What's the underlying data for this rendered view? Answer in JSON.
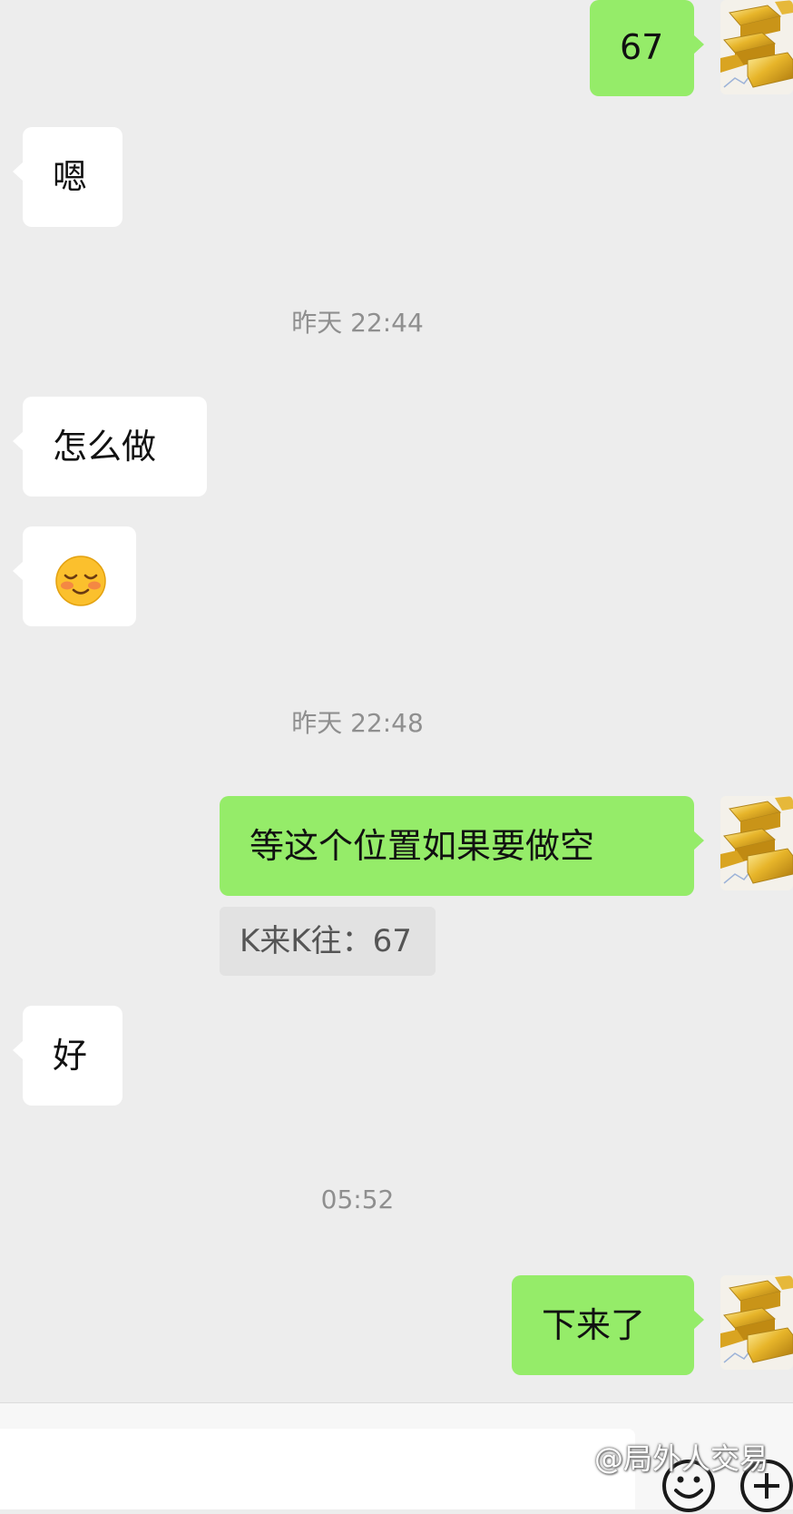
{
  "messages": {
    "m1": {
      "text": "67"
    },
    "m2": {
      "text": "嗯"
    },
    "t1": {
      "text": "昨天 22:44"
    },
    "m3": {
      "text": "怎么做"
    },
    "t2": {
      "text": "昨天 22:48"
    },
    "m5": {
      "text": "等这个位置如果要做空"
    },
    "m5_quote": {
      "text": "K来K往：67"
    },
    "m6": {
      "text": "好"
    },
    "t3": {
      "text": "05:52"
    },
    "m7": {
      "text": "下来了"
    }
  },
  "icons": {
    "emoji": "blushing-smile-emoji",
    "avatar": "gold-bars-avatar",
    "emoji_button": "smiley-icon",
    "more_button": "plus-circle-icon"
  },
  "watermark": {
    "text": "@局外人交易"
  },
  "colors": {
    "background": "#ededed",
    "outgoing_bubble": "#95ec69",
    "incoming_bubble": "#ffffff",
    "timestamp": "#8f8f8f"
  }
}
